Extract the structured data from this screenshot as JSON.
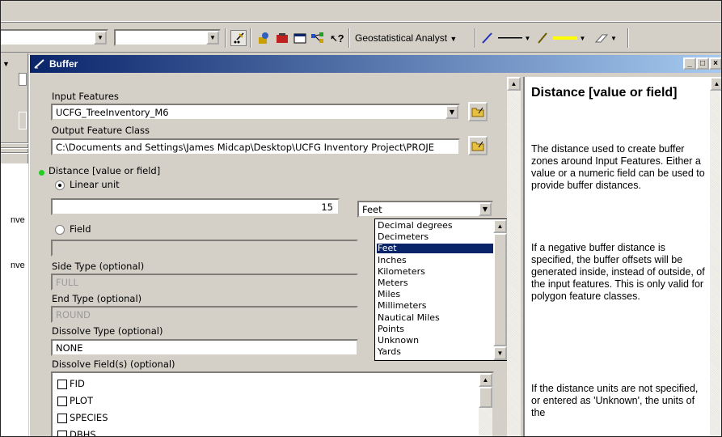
{
  "toolbar": {
    "geostatistical_label": "Geostatistical Analyst",
    "whats_this_label": "?"
  },
  "left_panel": {
    "fragment_1": "nve",
    "fragment_2": "nve"
  },
  "dialog": {
    "title": "Buffer",
    "controls": {
      "minimize": "_",
      "maximize": "□",
      "close": "×"
    },
    "input_features": {
      "label": "Input Features",
      "value": "UCFG_TreeInventory_M6"
    },
    "output_feature_class": {
      "label": "Output Feature Class",
      "value": "C:\\Documents and Settings\\James Midcap\\Desktop\\UCFG Inventory Project\\PROJE"
    },
    "distance": {
      "label": "Distance [value or field]",
      "linear_unit_label": "Linear unit",
      "value": "15",
      "unit_selected": "Feet",
      "field_label": "Field"
    },
    "side_type": {
      "label": "Side Type (optional)",
      "value": "FULL"
    },
    "end_type": {
      "label": "End Type (optional)",
      "value": "ROUND"
    },
    "dissolve_type": {
      "label": "Dissolve Type (optional)",
      "value": "NONE"
    },
    "dissolve_fields": {
      "label": "Dissolve Field(s) (optional)",
      "items": [
        "FID",
        "PLOT",
        "SPECIES",
        "DBHS"
      ]
    },
    "unit_options": [
      "Decimal degrees",
      "Decimeters",
      "Feet",
      "Inches",
      "Kilometers",
      "Meters",
      "Miles",
      "Millimeters",
      "Nautical Miles",
      "Points",
      "Unknown",
      "Yards"
    ],
    "unit_options_selected_index": 2
  },
  "help": {
    "title": "Distance [value or field]",
    "p1": "The distance used to create buffer zones around Input Features. Either a value or a numeric field can be used to provide buffer distances.",
    "p2": "If a negative buffer distance is specified, the buffer offsets will be generated inside, instead of outside, of the input features. This is only valid for polygon feature classes.",
    "p3": "If the distance units are not specified, or entered as 'Unknown', the units of the"
  },
  "colors": {
    "title_gradient_start": "#0a246a",
    "title_gradient_end": "#a6caf0",
    "selection": "#0a246a",
    "face": "#d4d0c8",
    "required_dot": "#22cc22"
  }
}
